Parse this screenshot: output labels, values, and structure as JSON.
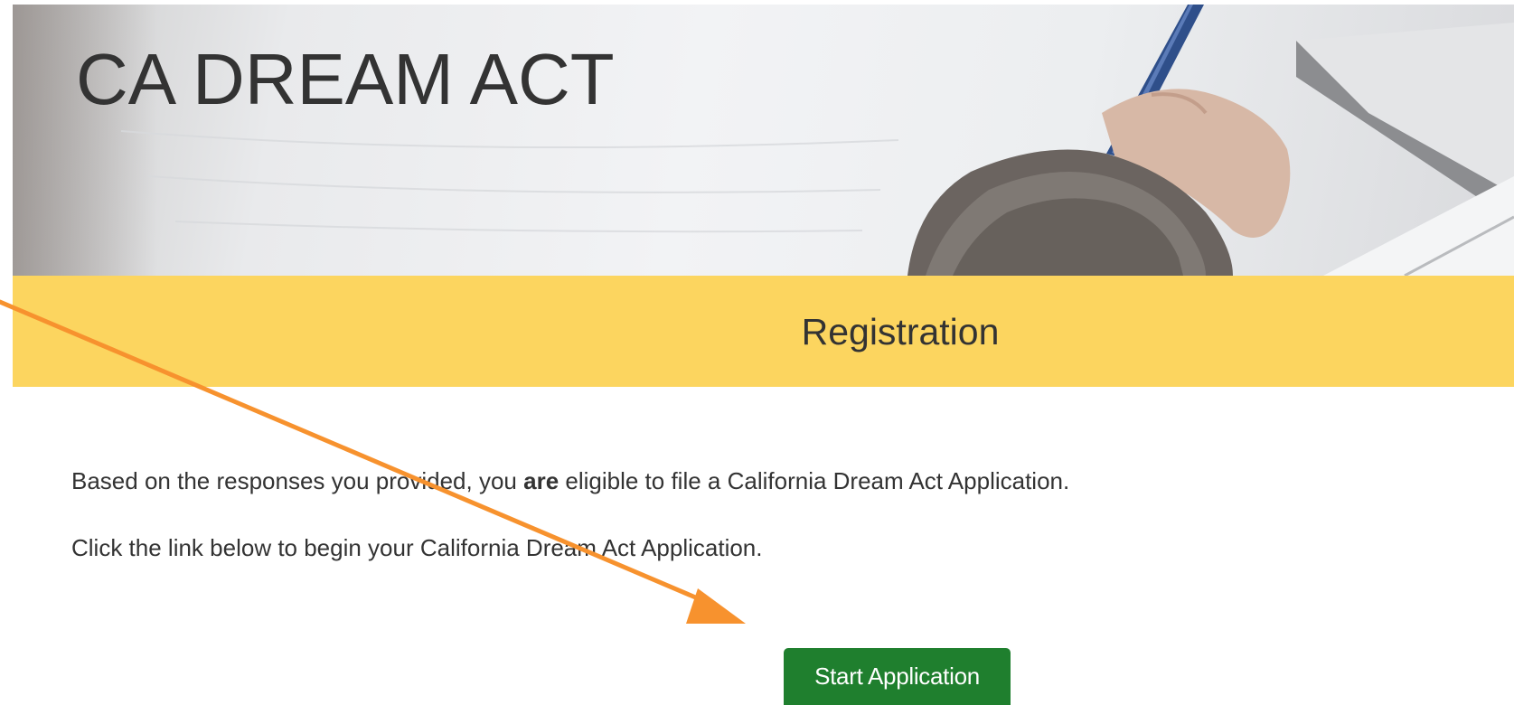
{
  "hero": {
    "title": "CA DREAM ACT"
  },
  "band": {
    "title": "Registration"
  },
  "content": {
    "line1_before": "Based on the responses you provided, you ",
    "line1_bold": "are",
    "line1_after": " eligible to file a California Dream Act Application.",
    "line2": "Click the link below to begin your California Dream Act Application."
  },
  "actions": {
    "start_label": "Start Application"
  },
  "colors": {
    "band": "#fcd55f",
    "button": "#1f7f2e",
    "annotation_arrow": "#f7922e",
    "text": "#333333"
  }
}
